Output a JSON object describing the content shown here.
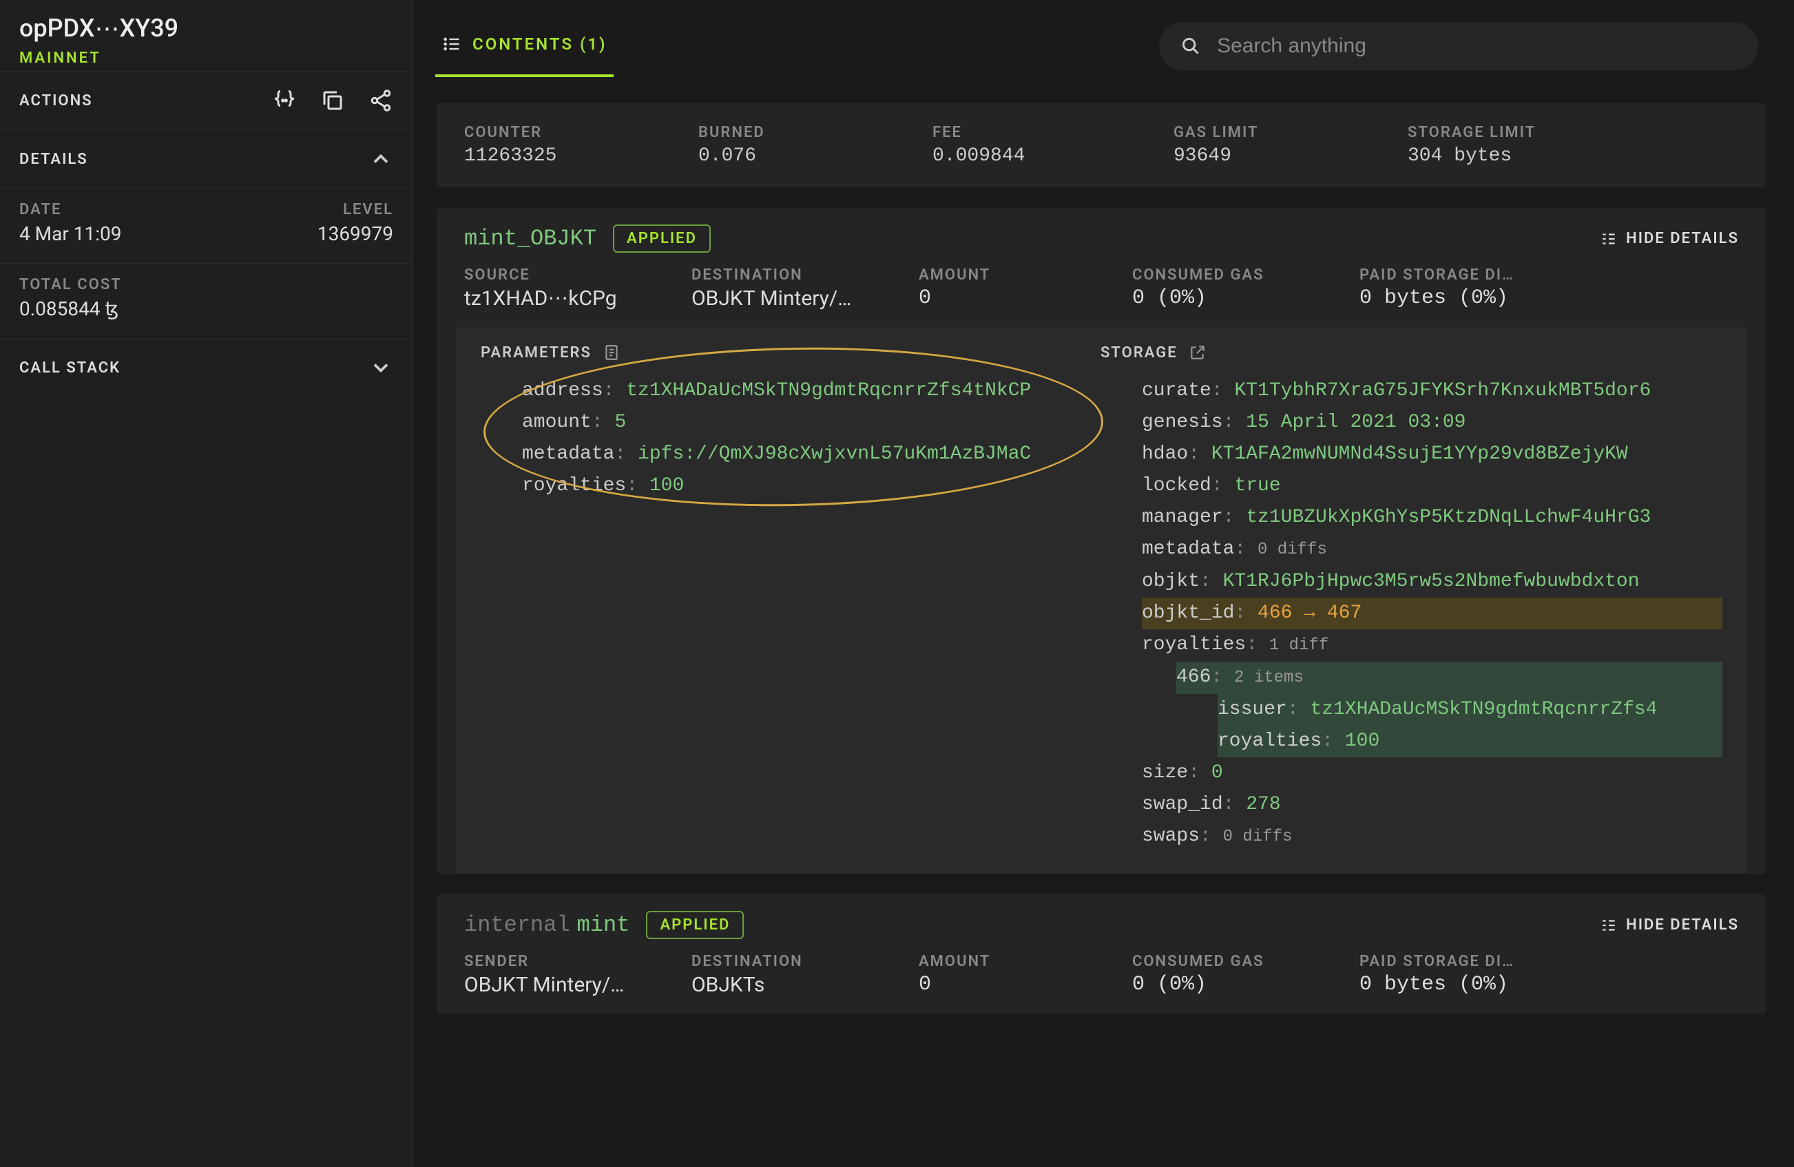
{
  "sidebar": {
    "title": "opPDX⋯XY39",
    "network": "MAINNET",
    "actions_label": "ACTIONS",
    "details_label": "DETAILS",
    "date_label": "DATE",
    "date_value": "4 Mar 11:09",
    "level_label": "LEVEL",
    "level_value": "1369979",
    "total_cost_label": "TOTAL COST",
    "total_cost_value": "0.085844 ꜩ",
    "call_stack_label": "CALL STACK"
  },
  "topbar": {
    "tab_label": "CONTENTS (1)",
    "search_placeholder": "Search anything"
  },
  "summary": {
    "counter_label": "COUNTER",
    "counter_value": "11263325",
    "burned_label": "BURNED",
    "burned_value": "0.076",
    "fee_label": "FEE",
    "fee_value": "0.009844",
    "gas_limit_label": "GAS LIMIT",
    "gas_limit_value": "93649",
    "storage_limit_label": "STORAGE LIMIT",
    "storage_limit_value": "304 bytes"
  },
  "op1": {
    "name": "mint_OBJKT",
    "status": "APPLIED",
    "hide_label": "HIDE DETAILS",
    "source_label": "SOURCE",
    "source_value": "tz1XHAD⋯kCPg",
    "dest_label": "DESTINATION",
    "dest_value": "OBJKT Mintery/…",
    "amount_label": "AMOUNT",
    "amount_value": "0",
    "gas_label": "CONSUMED GAS",
    "gas_value": "0 (0%)",
    "paid_label": "PAID STORAGE DI…",
    "paid_value": "0 bytes (0%)",
    "parameters_label": "PARAMETERS",
    "storage_label": "STORAGE",
    "params": {
      "address_k": "address",
      "address_v": "tz1XHADaUcMSkTN9gdmtRqcnrrZfs4tNkCP",
      "amount_k": "amount",
      "amount_v": "5",
      "metadata_k": "metadata",
      "metadata_v": "ipfs://QmXJ98cXwjxvnL57uKm1AzBJMaC",
      "royalties_k": "royalties",
      "royalties_v": "100"
    },
    "storage": {
      "curate_k": "curate",
      "curate_v": "KT1TybhR7XraG75JFYKSrh7KnxukMBT5dor6",
      "genesis_k": "genesis",
      "genesis_v": "15 April 2021 03:09",
      "hdao_k": "hdao",
      "hdao_v": "KT1AFA2mwNUMNd4SsujE1YYp29vd8BZejyKW",
      "locked_k": "locked",
      "locked_v": "true",
      "manager_k": "manager",
      "manager_v": "tz1UBZUkXpKGhYsP5KtzDNqLLchwF4uHrG3",
      "metadata_k": "metadata",
      "metadata_v": "0 diffs",
      "objkt_k": "objkt",
      "objkt_v": "KT1RJ6PbjHpwc3M5rw5s2Nbmefwbuwbdxton",
      "objkt_id_k": "objkt_id",
      "objkt_id_old": "466",
      "objkt_id_new": "467",
      "royalties_k": "royalties",
      "royalties_v": "1 diff",
      "roy_item_k": "466",
      "roy_item_v": "2 items",
      "issuer_k": "issuer",
      "issuer_v": "tz1XHADaUcMSkTN9gdmtRqcnrrZfs4",
      "roy_inner_k": "royalties",
      "roy_inner_v": "100",
      "size_k": "size",
      "size_v": "0",
      "swap_id_k": "swap_id",
      "swap_id_v": "278",
      "swaps_k": "swaps",
      "swaps_v": "0 diffs"
    }
  },
  "op2": {
    "prefix": "internal",
    "name": "mint",
    "status": "APPLIED",
    "hide_label": "HIDE DETAILS",
    "sender_label": "SENDER",
    "sender_value": "OBJKT Mintery/…",
    "dest_label": "DESTINATION",
    "dest_value": "OBJKTs",
    "amount_label": "AMOUNT",
    "amount_value": "0",
    "gas_label": "CONSUMED GAS",
    "gas_value": "0 (0%)",
    "paid_label": "PAID STORAGE DI…",
    "paid_value": "0 bytes (0%)"
  }
}
